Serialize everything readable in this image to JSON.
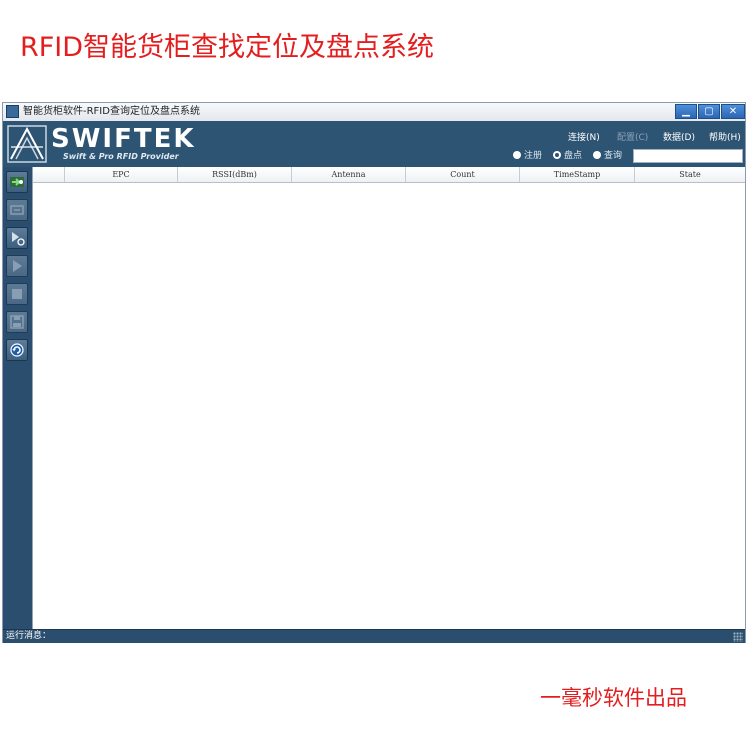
{
  "banner": {
    "headline": "RFID智能货柜查找定位及盘点系统",
    "credit": "一毫秒软件出品"
  },
  "window": {
    "title": "智能货柜软件-RFID查询定位及盘点系统",
    "controls": {
      "minimize": "▁",
      "maximize": "▢",
      "close": "✕"
    }
  },
  "header": {
    "brand": "SWIFTEK",
    "tagline": "Swift & Pro RFID Provider",
    "menu": {
      "connect": "连接(N)",
      "config": "配置(C)",
      "data": "数据(D)",
      "help": "帮助(H)"
    },
    "modes": [
      {
        "label": "注册",
        "checked": false
      },
      {
        "label": "盘点",
        "checked": true
      },
      {
        "label": "查询",
        "checked": false
      }
    ],
    "search_value": ""
  },
  "toolbar": {
    "icons": [
      "connect-icon",
      "disconnect-icon",
      "play-settings-icon",
      "play-icon",
      "stop-icon",
      "save-icon",
      "refresh-icon"
    ]
  },
  "table": {
    "columns": [
      "EPC",
      "RSSI(dBm)",
      "Antenna",
      "Count",
      "TimeStamp",
      "State"
    ],
    "rows": []
  },
  "status": {
    "label": "运行消息："
  }
}
